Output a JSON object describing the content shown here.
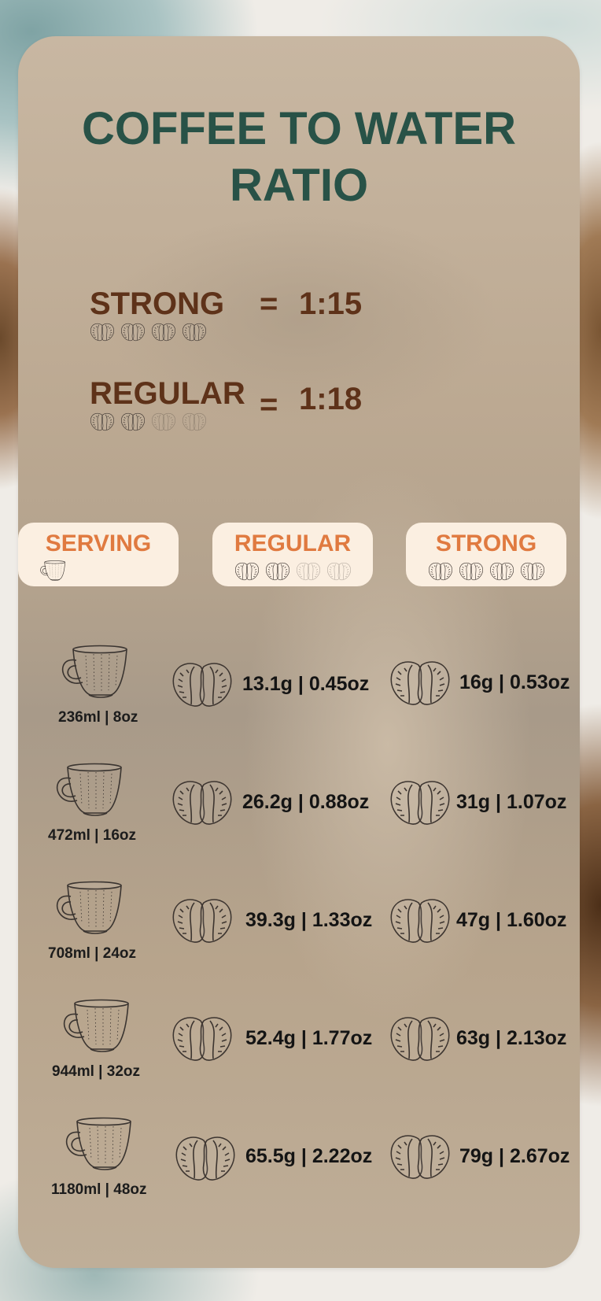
{
  "title": "COFFEE TO WATER RATIO",
  "ratios": [
    {
      "name": "STRONG",
      "equals": "=",
      "ratio": "1:15",
      "strength": 4,
      "max": 4
    },
    {
      "name": "REGULAR",
      "equals": "=",
      "ratio": "1:18",
      "strength": 2,
      "max": 4
    }
  ],
  "headers": {
    "serving": "SERVING",
    "regular": "REGULAR",
    "strong": "STRONG"
  },
  "rows": [
    {
      "serving": "236ml | 8oz",
      "regular": "13.1g | 0.45oz",
      "strong": "16g | 0.53oz"
    },
    {
      "serving": "472ml | 16oz",
      "regular": "26.2g | 0.88oz",
      "strong": "31g | 1.07oz"
    },
    {
      "serving": "708ml | 24oz",
      "regular": "39.3g | 1.33oz",
      "strong": "47g | 1.60oz"
    },
    {
      "serving": "944ml | 32oz",
      "regular": "52.4g | 1.77oz",
      "strong": "63g | 2.13oz"
    },
    {
      "serving": "1180ml | 48oz",
      "regular": "65.5g | 2.22oz",
      "strong": "79g | 2.67oz"
    }
  ],
  "colors": {
    "title": "#285247",
    "ratio_text": "#5e3219",
    "pill_text": "#e07a40",
    "pill_bg": "#fbefe1"
  },
  "icons": {
    "bean": "coffee-bean-icon",
    "cup": "coffee-cup-icon"
  }
}
